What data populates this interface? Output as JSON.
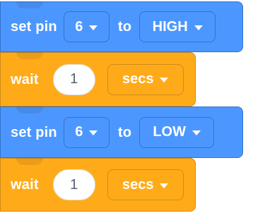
{
  "blocks": [
    {
      "type": "set_pin",
      "prefix": "set pin",
      "pin": "6",
      "middle": "to",
      "level": "HIGH"
    },
    {
      "type": "wait",
      "prefix": "wait",
      "value": "1",
      "unit": "secs"
    },
    {
      "type": "set_pin",
      "prefix": "set pin",
      "pin": "6",
      "middle": "to",
      "level": "LOW"
    },
    {
      "type": "wait",
      "prefix": "wait",
      "value": "1",
      "unit": "secs"
    }
  ],
  "colors": {
    "pin_block": "#4c97ff",
    "pin_border": "#3373cc",
    "wait_block": "#ffab19",
    "wait_border": "#cf8b17",
    "number_text": "#575e75"
  },
  "icons": {
    "dropdown": "chevron-down-icon"
  }
}
